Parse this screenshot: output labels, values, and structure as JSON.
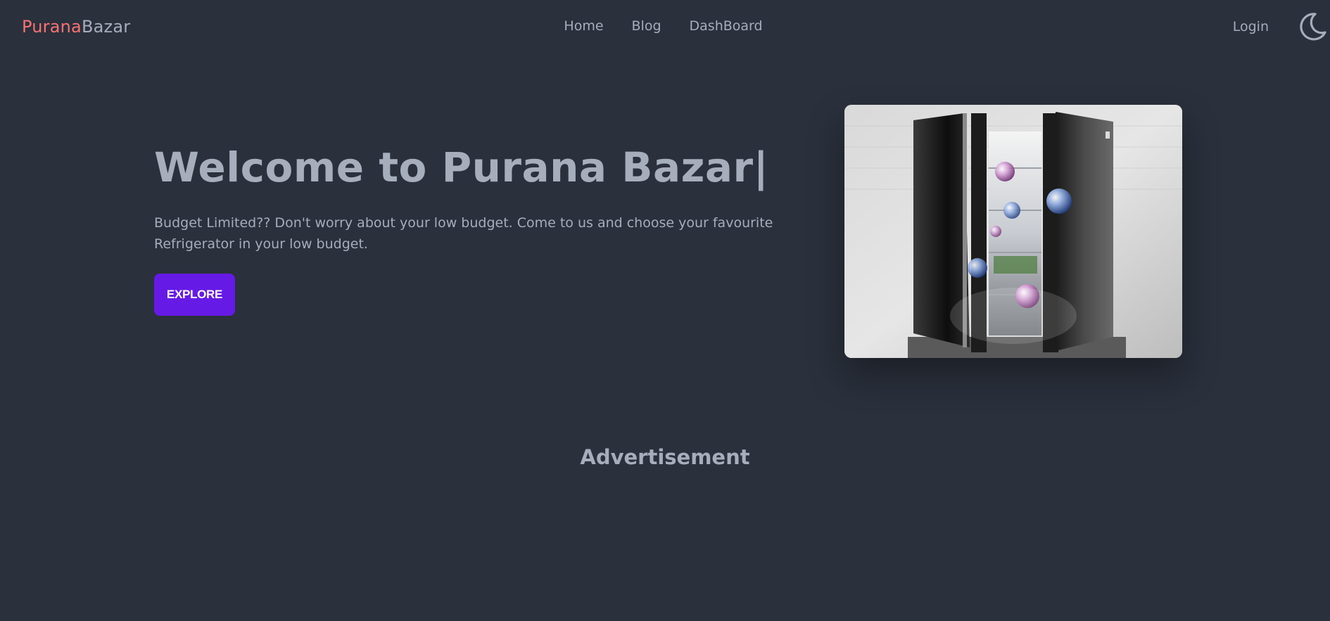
{
  "navbar": {
    "brand_part1": "Purana",
    "brand_part2": "Bazar",
    "links": [
      "Home",
      "Blog",
      "DashBoard"
    ],
    "login_label": "Login",
    "theme_toggle_icon": "moon-icon"
  },
  "hero": {
    "title": "Welcome to Purana Bazar|",
    "description": "Budget Limited?? Don't worry about your low budget. Come to us and choose your favourite Refrigerator in your low budget.",
    "button_label": "EXPLORE",
    "image_icon": "refrigerator-image"
  },
  "advertisement": {
    "title": "Advertisement"
  },
  "colors": {
    "background": "#2a303c",
    "text": "#a6adbb",
    "brand_accent": "#f87272",
    "primary_button": "#661ae6"
  }
}
